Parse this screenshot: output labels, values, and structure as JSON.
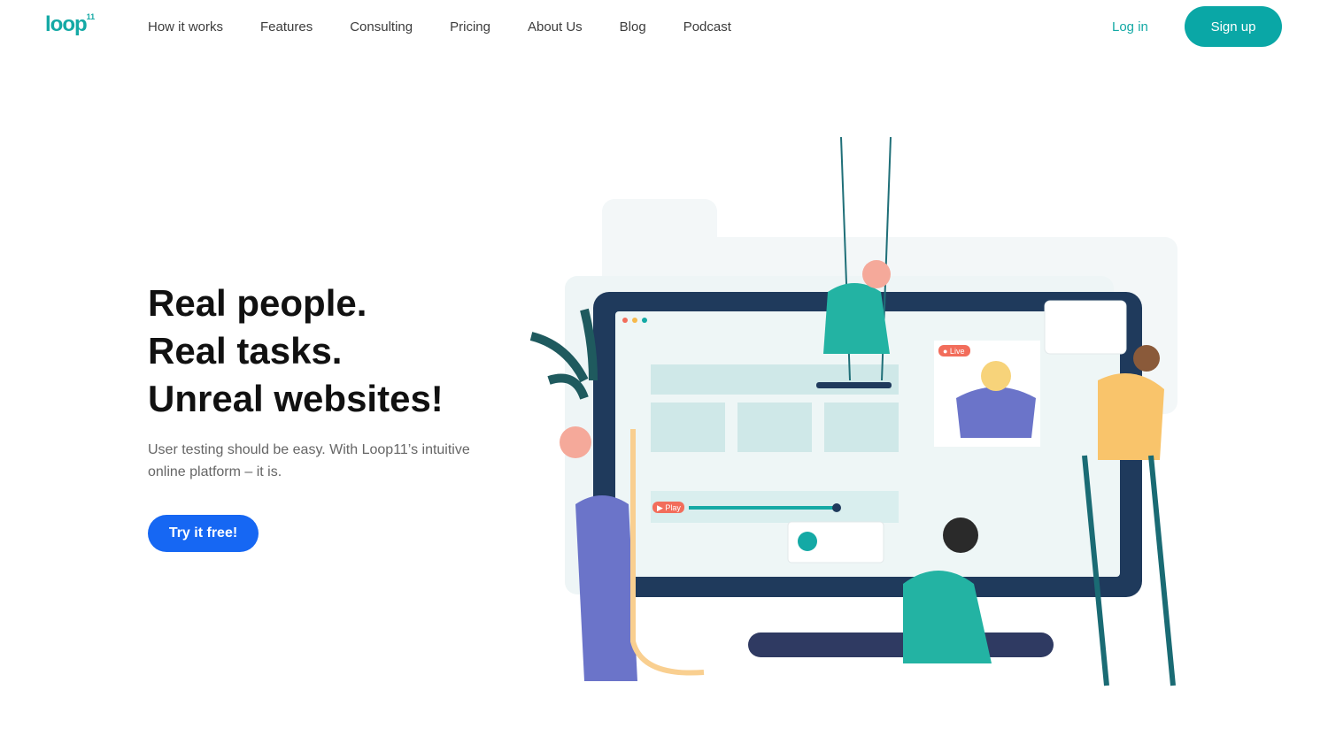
{
  "nav": {
    "logo": "loop",
    "logo_sup": "11",
    "items": [
      "How it works",
      "Features",
      "Consulting",
      "Pricing",
      "About Us",
      "Blog",
      "Podcast"
    ],
    "login": "Log in",
    "signup": "Sign up"
  },
  "hero": {
    "line1": "Real people.",
    "line2": "Real tasks.",
    "line3": "Unreal websites!",
    "subtitle": "User testing should be easy. With Loop11’s intuitive online platform – it is.",
    "cta": "Try it free!"
  },
  "illustration": {
    "play_label": "▶ Play",
    "live_label": "● Live"
  },
  "colors": {
    "brand": "#0aa7a6",
    "cta": "#1667f3"
  }
}
